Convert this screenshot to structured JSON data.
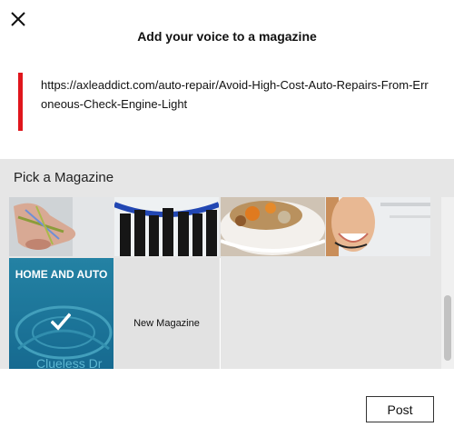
{
  "dialog": {
    "title": "Add your voice to a magazine",
    "close_icon": "close-icon"
  },
  "article": {
    "url": "https://axleaddict.com/auto-repair/Avoid-High-Cost-Auto-Repairs-From-Erroneous-Check-Engine-Light",
    "accent_color": "#e0161c"
  },
  "picker": {
    "label": "Pick a Magazine",
    "magazines": [
      {
        "image": "hand-photo"
      },
      {
        "image": "business-people-photo"
      },
      {
        "image": "food-bowl-photo"
      },
      {
        "image": "headset-woman-photo"
      },
      {
        "title": "HOME AND AUTO",
        "selected": true,
        "icon": "checkmark-icon",
        "image": "dashboard-photo",
        "background_text": "Clueless Dr"
      },
      {
        "title": "New Magazine",
        "kind": "create-new"
      }
    ]
  },
  "footer": {
    "post_label": "Post"
  }
}
